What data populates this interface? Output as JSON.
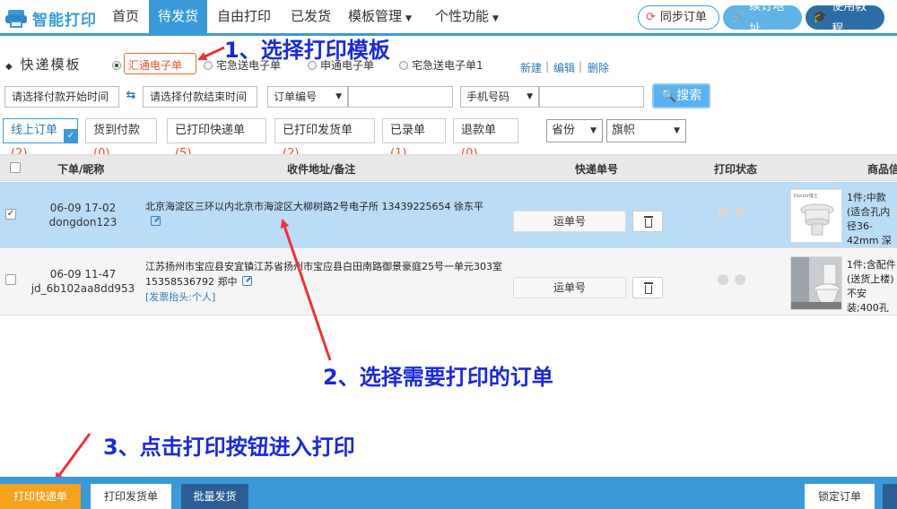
{
  "app": {
    "name": "智能打印"
  },
  "nav": {
    "items": [
      {
        "label": "首页"
      },
      {
        "label": "待发货"
      },
      {
        "label": "自由打印"
      },
      {
        "label": "已发货"
      },
      {
        "label": "模板管理"
      },
      {
        "label": "个性功能"
      }
    ],
    "active": "待发货",
    "sync_label": "同步订单",
    "bind_label": "续订地址",
    "tutorial_label": "使用教程"
  },
  "template_section": {
    "title": "快递模板",
    "options": [
      {
        "label": "汇通电子单",
        "selected": true
      },
      {
        "label": "宅急送电子单",
        "selected": false
      },
      {
        "label": "申通电子单",
        "selected": false
      },
      {
        "label": "宅急送电子单1",
        "selected": false
      }
    ],
    "actions": [
      "新建",
      "编辑",
      "删除"
    ]
  },
  "filters": {
    "pay_start": "请选择付款开始时间",
    "pay_end": "请选择付款结束时间",
    "order_select": "订单编号",
    "phone_select": "手机号码",
    "search_label": "搜索"
  },
  "status_tabs": [
    {
      "label": "线上订单",
      "count": "(2)",
      "active": true
    },
    {
      "label": "货到付款",
      "count": "(0)",
      "active": false
    },
    {
      "label": "已打印快递单",
      "count": "(5)",
      "active": false
    },
    {
      "label": "已打印发货单",
      "count": "(2)",
      "active": false
    },
    {
      "label": "已录单",
      "count": "(1)",
      "active": false
    },
    {
      "label": "退款单",
      "count": "(0)",
      "active": false
    }
  ],
  "province_select": "省份",
  "city_select": "旗帜",
  "table": {
    "headers": [
      "下单/昵称",
      "收件地址/备注",
      "快递单号",
      "打印状态",
      "商品信"
    ],
    "rows": [
      {
        "checked": true,
        "date": "06-09 17-02",
        "nick": "dongdon123",
        "address": "北京海淀区三环以内北京市海淀区大柳树路2号电子所 13439225654 徐东平",
        "invoice": "",
        "waybill_label": "运单号",
        "product_text": "1件;中款(适合孔内径36-42mm 深",
        "product_brand": "Doctor博士"
      },
      {
        "checked": false,
        "date": "06-09 11-47",
        "nick": "jd_6b102aa8dd953",
        "address": "江苏扬州市宝应县安宜镇江苏省扬州市宝应县白田南路御景豪庭25号一单元303室 15358536792 郑中",
        "invoice": "[发票抬头:个人]",
        "waybill_label": "运单号",
        "product_text": "1件;含配件(送货上楼)不安装;400孔",
        "product_brand": ""
      }
    ]
  },
  "annotations": {
    "step1": "1、选择打印模板",
    "step2": "2、选择需要打印的订单",
    "step3": "3、点击打印按钮进入打印"
  },
  "bottom": {
    "print_waybill": "打印快递单",
    "print_invoice": "打印发货单",
    "batch_ship": "批量发货",
    "lock_order": "锁定订单"
  },
  "colors": {
    "brand": "#3a9ad9",
    "annotation": "#1a2ad6",
    "arrow": "#e8343a",
    "print_button": "#f5a21c",
    "selected_row": "#b9dcf7"
  }
}
